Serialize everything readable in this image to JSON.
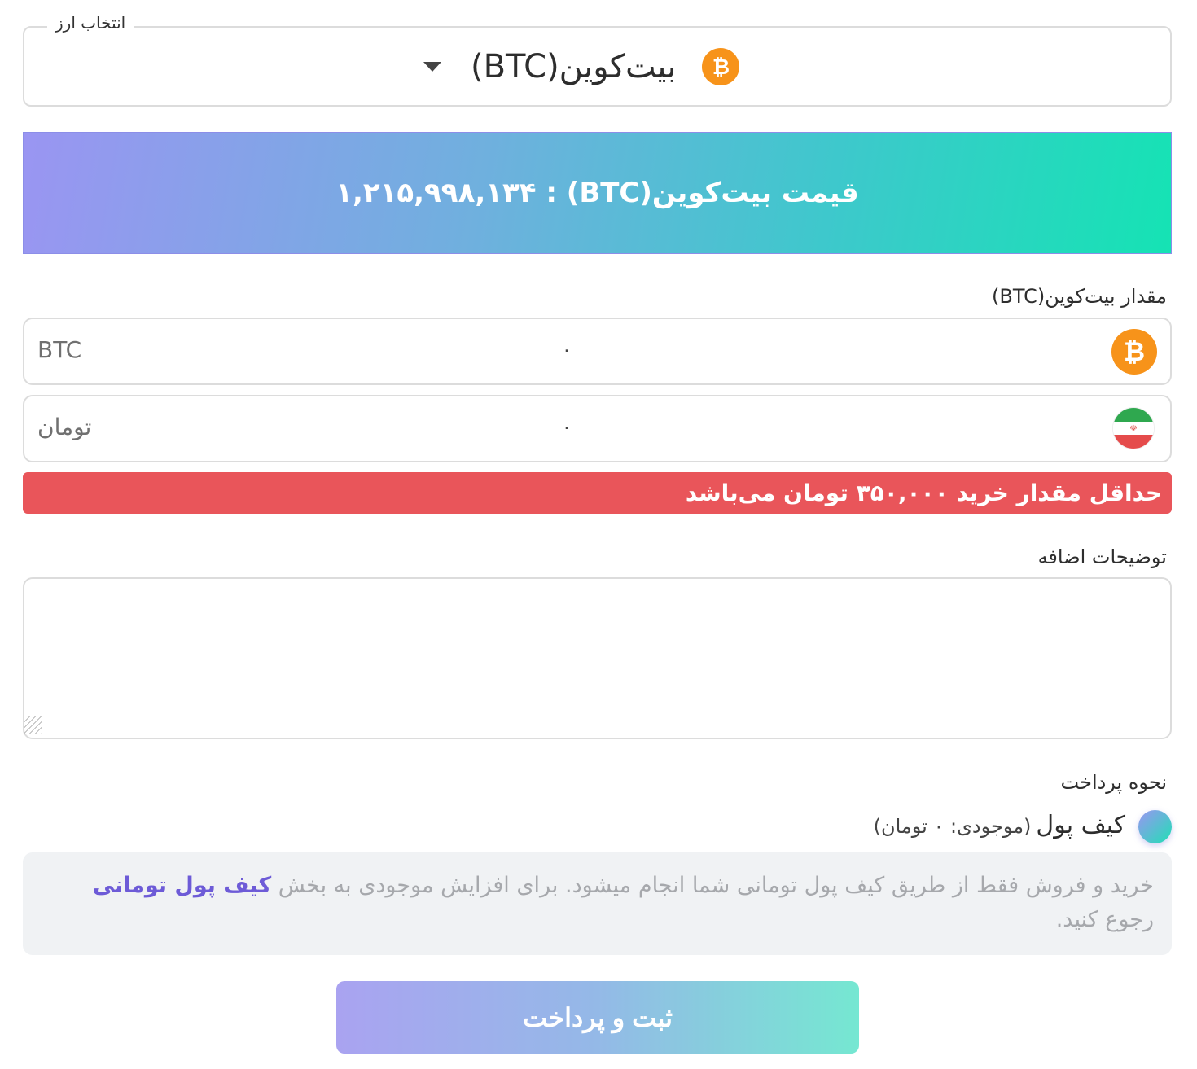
{
  "currency_select": {
    "legend": "انتخاب ارز",
    "selected": "بیت‌کوین(BTC)",
    "icon": "bitcoin-icon"
  },
  "price_banner": {
    "text": "قیمت بیت‌کوین(BTC) : ۱,۲۱۵,۹۹۸,۱۳۴"
  },
  "amount": {
    "label": "مقدار بیت‌کوین(BTC)",
    "crypto_unit": "BTC",
    "crypto_value": "۰",
    "toman_unit": "تومان",
    "toman_value": "۰"
  },
  "error": {
    "text": "حداقل مقدار خرید ۳۵۰,۰۰۰ تومان می‌باشد"
  },
  "notes": {
    "label": "توضیحات اضافه",
    "value": ""
  },
  "payment": {
    "label": "نحوه پرداخت",
    "option_label": "کیف پول",
    "option_balance": "(موجودی: ۰ تومان)",
    "info_text": "خرید و فروش فقط از طریق کیف پول تومانی شما انجام میشود. برای افزایش موجودی به بخش ",
    "info_link": "کیف پول تومانی",
    "info_text_end": " رجوع کنید."
  },
  "submit": {
    "label": "ثبت و پرداخت"
  },
  "colors": {
    "bitcoin": "#f7931a",
    "error": "#e9555a",
    "link": "#6d5bd7"
  }
}
